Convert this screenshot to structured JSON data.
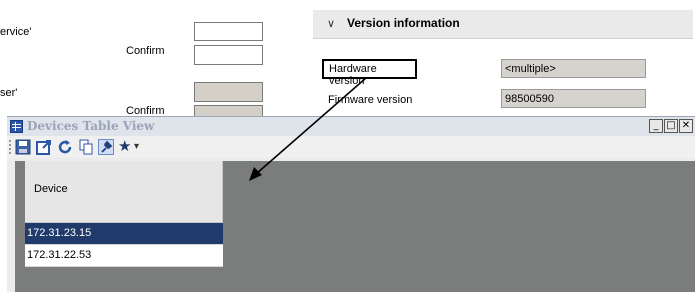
{
  "background_form": {
    "label_service": "ervice'",
    "label_confirm_1": "Confirm",
    "label_user": "ser'",
    "label_confirm_2": "Confirm"
  },
  "version_section": {
    "title": "Version information",
    "expander_glyph": "∨",
    "hardware_label": "Hardware version",
    "hardware_value": "<multiple>",
    "firmware_label": "Firmware version",
    "firmware_value": "98500590"
  },
  "window": {
    "title": "Devices Table View",
    "minimize": "_",
    "maximize": "□",
    "close": "✕"
  },
  "toolbar": {
    "icons": [
      "save-icon",
      "export-icon",
      "refresh-icon",
      "copy-icon",
      "pin-icon",
      "favorite-icon",
      "dropdown-arrow-icon"
    ],
    "favorite_glyph": "★",
    "dropdown_glyph": "▾"
  },
  "table": {
    "header": "Device",
    "rows": [
      "172.31.23.15",
      "172.31.22.53"
    ],
    "selected_index": 0
  },
  "colors": {
    "selection": "#1f3a6b",
    "content_bg": "#7a7d7c",
    "title_text": "#9aa4b8"
  }
}
